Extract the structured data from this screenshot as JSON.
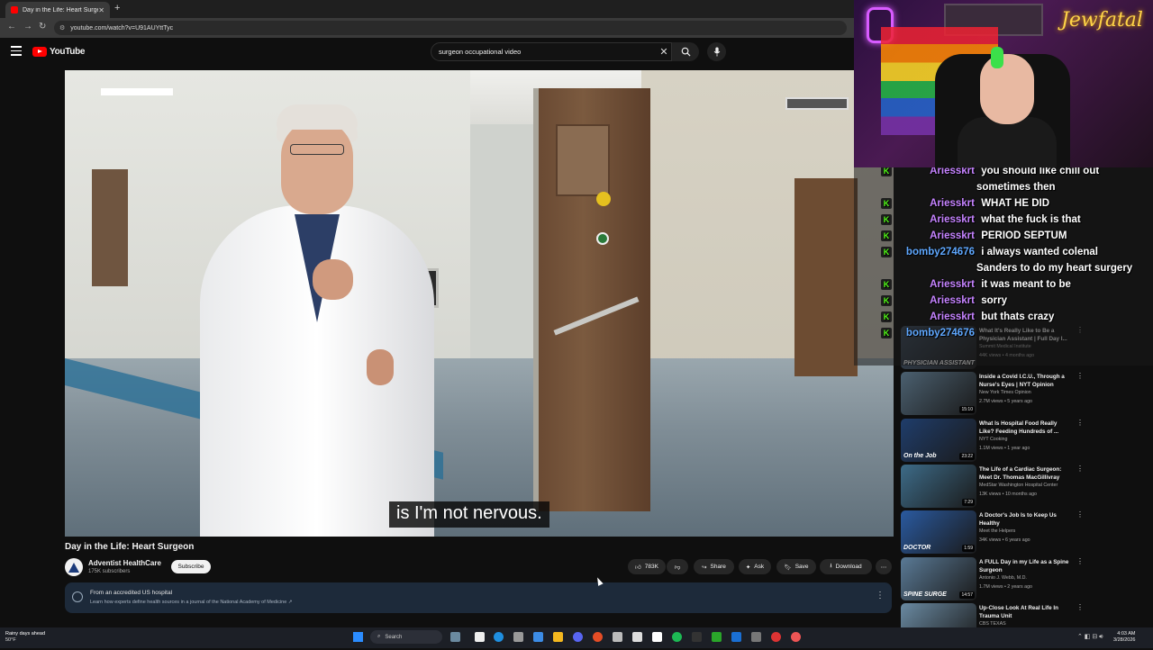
{
  "browser": {
    "tab_title": "Day in the Life: Heart Surgeon",
    "url": "youtube.com/watch?v=U91AUYttTyc"
  },
  "youtube": {
    "logo_text": "YouTube",
    "search_query": "surgeon occupational video"
  },
  "video": {
    "subtitle": "is I'm not nervous.",
    "title": "Day in the Life: Heart Surgeon",
    "channel": "Adventist HealthCare",
    "subscribers": "175K subscribers",
    "subscribe_label": "Subscribe",
    "likes": "783K",
    "share_label": "Share",
    "ask_label": "Ask",
    "save_label": "Save",
    "download_label": "Download"
  },
  "notice": {
    "title": "From an accredited US hospital",
    "subtitle": "Learn how experts define health sources in a journal of the National Academy of Medicine ↗"
  },
  "chat": [
    {
      "user": "Ariesskrt",
      "lines": [
        "you should like chill out",
        "sometimes then"
      ],
      "color": "#c583ff"
    },
    {
      "user": "Ariesskrt",
      "lines": [
        "WHAT HE DID"
      ],
      "color": "#c583ff"
    },
    {
      "user": "Ariesskrt",
      "lines": [
        "what the fuck is that"
      ],
      "color": "#c583ff"
    },
    {
      "user": "Ariesskrt",
      "lines": [
        "PERIOD SEPTUM"
      ],
      "color": "#c583ff"
    },
    {
      "user": "bomby274676",
      "lines": [
        "i always wanted colenal",
        "Sanders to do my heart surgery"
      ],
      "color": "#5fa8ff"
    },
    {
      "user": "Ariesskrt",
      "lines": [
        "it was meant to be"
      ],
      "color": "#c583ff"
    },
    {
      "user": "Ariesskrt",
      "lines": [
        "sorry"
      ],
      "color": "#c583ff"
    },
    {
      "user": "Ariesskrt",
      "lines": [
        "but thats crazy"
      ],
      "color": "#c583ff"
    },
    {
      "user": "bomby274676",
      "lines": [
        ""
      ],
      "color": "#5fa8ff"
    }
  ],
  "recommendations": [
    {
      "title": "What It's Really Like to Be a Physician Assistant | Full Day I...",
      "channel": "Summit Medical Institute",
      "meta": "44K views • 4 months ago",
      "duration": "",
      "thumb": "#3b4a5c"
    },
    {
      "title": "Inside a Covid I.C.U., Through a Nurse's Eyes | NYT Opinion",
      "channel": "New York Times Opinion",
      "meta": "2.7M views • 5 years ago",
      "duration": "15:10",
      "thumb": "#4b6070"
    },
    {
      "title": "What Is Hospital Food Really Like? Feeding Hundreds of ...",
      "channel": "NYT Cooking",
      "meta": "1.1M views • 1 year ago",
      "duration": "23:22",
      "thumb": "#1f3d6b"
    },
    {
      "title": "The Life of a Cardiac Surgeon: Meet Dr. Thomas MacGillivray",
      "channel": "MedStar Washington Hospital Center",
      "meta": "13K views • 10 months ago",
      "duration": "7:29",
      "thumb": "#3d6b88"
    },
    {
      "title": "A Doctor's Job Is to Keep Us Healthy",
      "channel": "Meet the Helpers",
      "meta": "34K views • 6 years ago",
      "duration": "1:59",
      "thumb": "#2a5aa0"
    },
    {
      "title": "A FULL Day in my Life as a Spine Surgeon",
      "channel": "Antonio J. Webb, M.D.",
      "meta": "1.7M views • 2 years ago",
      "duration": "14:57",
      "thumb": "#5a7a96"
    },
    {
      "title": "Up-Close Look At Real Life In Trauma Unit",
      "channel": "CBS TEXAS",
      "meta": "",
      "duration": "",
      "thumb": "#6a8aa2"
    }
  ],
  "thumb_labels": {
    "physician": "PHYSICIAN ASSISTANT",
    "on_the_job": "On the Job",
    "doctor": "DOCTOR",
    "spine": "SPINE SURGE"
  },
  "taskbar": {
    "weather_line1": "Rainy days ahead",
    "weather_line2": "50°F",
    "search_label": "Search",
    "time": "4:03 AM",
    "date": "3/28/2026"
  },
  "webcam": {
    "neon_text": "Jewfatal"
  }
}
